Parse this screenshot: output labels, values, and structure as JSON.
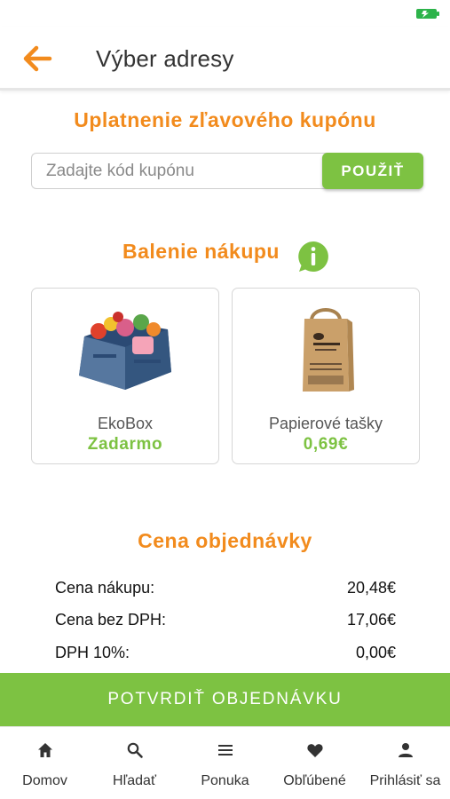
{
  "colors": {
    "accent_orange": "#f28b1d",
    "accent_green": "#7dc242",
    "text_dark": "#222222",
    "text_muted": "#555555"
  },
  "status_bar": {
    "battery_icon": "battery-charging-icon"
  },
  "header": {
    "back_icon": "arrow-left-icon",
    "title": "Výber adresy"
  },
  "coupon": {
    "title": "Uplatnenie zľavového kupónu",
    "placeholder": "Zadajte kód kupónu",
    "value": "",
    "button_label": "POUŽIŤ"
  },
  "packaging": {
    "title": "Balenie nákupu",
    "info_icon": "info-chat-icon",
    "options": [
      {
        "name": "EkoBox",
        "price": "Zadarmo",
        "image": "ekobox-crate-image"
      },
      {
        "name": "Papierové tašky",
        "price": "0,69€",
        "image": "paper-bag-image"
      }
    ]
  },
  "order": {
    "title": "Cena objednávky",
    "rows": [
      {
        "label": "Cena nákupu:",
        "value": "20,48€"
      },
      {
        "label": "Cena bez DPH:",
        "value": "17,06€"
      },
      {
        "label": "DPH 10%:",
        "value": "0,00€"
      }
    ]
  },
  "confirm_button": "POTVRDIŤ OBJEDNÁVKU",
  "bottom_nav": [
    {
      "label": "Domov",
      "icon": "home-icon"
    },
    {
      "label": "Hľadať",
      "icon": "search-icon"
    },
    {
      "label": "Ponuka",
      "icon": "menu-icon"
    },
    {
      "label": "Obľúbené",
      "icon": "heart-icon"
    },
    {
      "label": "Prihlásiť sa",
      "icon": "user-icon"
    }
  ]
}
